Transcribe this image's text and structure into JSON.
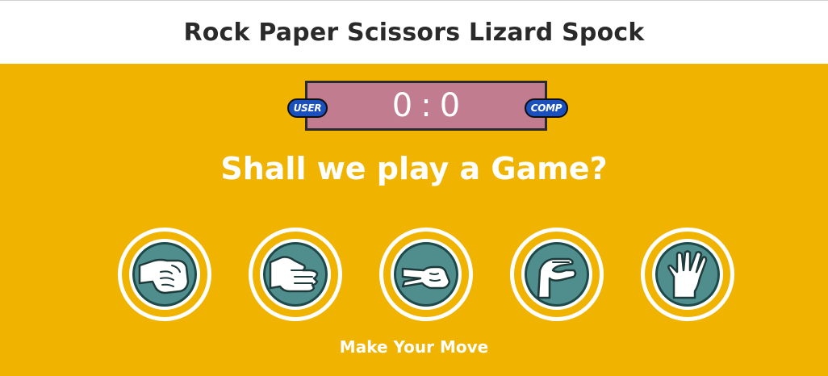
{
  "header": {
    "title": "Rock Paper Scissors Lizard Spock"
  },
  "scoreboard": {
    "user_label": "USER",
    "comp_label": "COMP",
    "user_score": "0",
    "separator": ":",
    "comp_score": "0"
  },
  "main": {
    "prompt": "Shall we play a Game?",
    "footer": "Make Your Move"
  },
  "choices": [
    {
      "name": "rock",
      "icon": "rock-hand-icon"
    },
    {
      "name": "paper",
      "icon": "paper-hand-icon"
    },
    {
      "name": "scissors",
      "icon": "scissors-hand-icon"
    },
    {
      "name": "lizard",
      "icon": "lizard-hand-icon"
    },
    {
      "name": "spock",
      "icon": "spock-hand-icon"
    }
  ],
  "colors": {
    "background": "#f0b400",
    "scoreboard": "#c27c90",
    "badge": "#1a4fbe",
    "icon_fill": "#4f8e8c"
  }
}
